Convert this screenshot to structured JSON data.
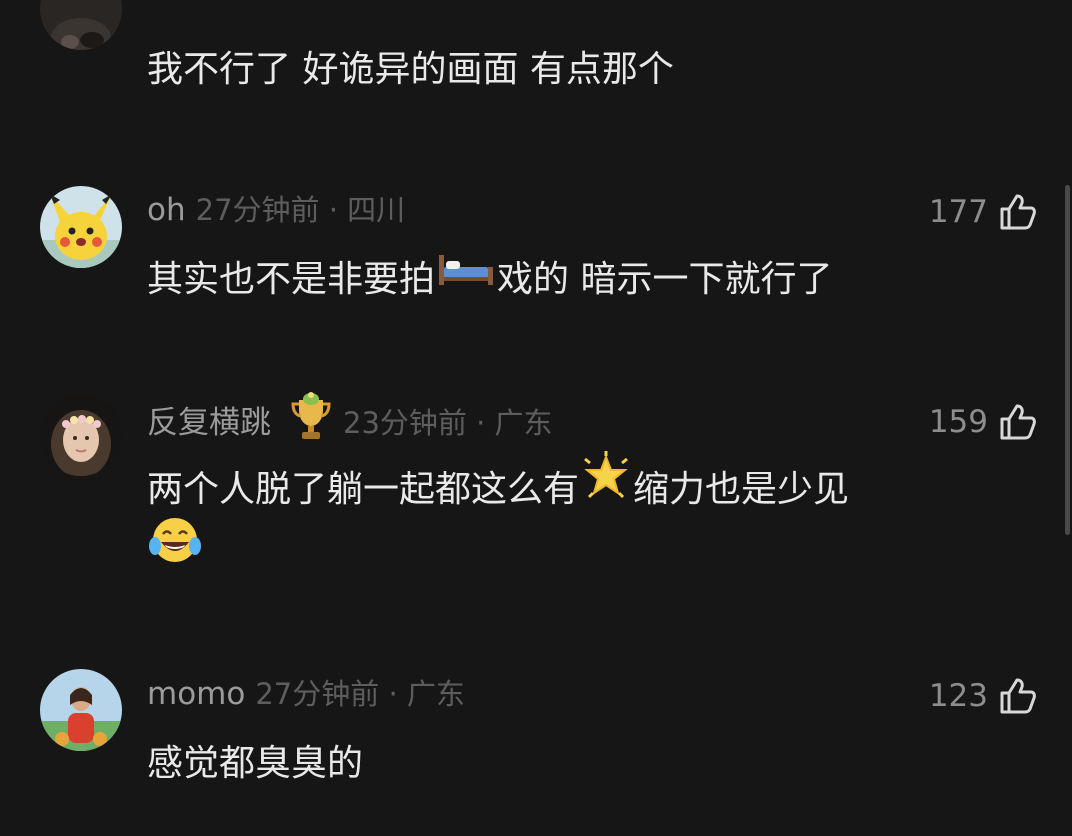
{
  "comments": [
    {
      "username": "",
      "meta": "",
      "likes": "",
      "text": "我不行了 好诡异的画面 有点那个",
      "avatar": "dark-portrait-avatar"
    },
    {
      "username": "oh",
      "meta": "27分钟前 · 四川",
      "likes": "177",
      "text_before": "其实也不是非要拍",
      "emoji": "bed-emoji",
      "text_after": "戏的 暗示一下就行了",
      "avatar": "pikachu-avatar"
    },
    {
      "username": "反复横跳",
      "badge": "trophy-badge",
      "meta": "23分钟前 · 广东",
      "likes": "159",
      "text_before": "两个人脱了躺一起都这么有",
      "emoji": "glowing-star-emoji",
      "text_after": "缩力也是少见",
      "emoji_line2": "tears-of-joy-emoji",
      "avatar": "girl-flower-crown-avatar"
    },
    {
      "username": "momo",
      "meta": "27分钟前 · 广东",
      "likes": "123",
      "text": "感觉都臭臭的",
      "avatar": "beach-girl-avatar"
    }
  ],
  "colors": {
    "background": "#161616",
    "username": "#9b9b9b",
    "meta": "#5d5d5d",
    "text": "#e9e9e9"
  }
}
